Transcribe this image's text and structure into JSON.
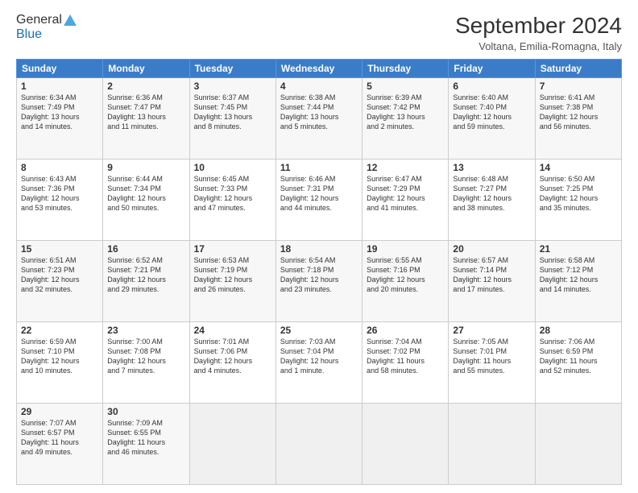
{
  "header": {
    "logo": {
      "line1": "General",
      "line2": "Blue"
    },
    "title": "September 2024",
    "subtitle": "Voltana, Emilia-Romagna, Italy"
  },
  "days_of_week": [
    "Sunday",
    "Monday",
    "Tuesday",
    "Wednesday",
    "Thursday",
    "Friday",
    "Saturday"
  ],
  "weeks": [
    [
      {
        "day": "1",
        "info": "Sunrise: 6:34 AM\nSunset: 7:49 PM\nDaylight: 13 hours\nand 14 minutes."
      },
      {
        "day": "2",
        "info": "Sunrise: 6:36 AM\nSunset: 7:47 PM\nDaylight: 13 hours\nand 11 minutes."
      },
      {
        "day": "3",
        "info": "Sunrise: 6:37 AM\nSunset: 7:45 PM\nDaylight: 13 hours\nand 8 minutes."
      },
      {
        "day": "4",
        "info": "Sunrise: 6:38 AM\nSunset: 7:44 PM\nDaylight: 13 hours\nand 5 minutes."
      },
      {
        "day": "5",
        "info": "Sunrise: 6:39 AM\nSunset: 7:42 PM\nDaylight: 13 hours\nand 2 minutes."
      },
      {
        "day": "6",
        "info": "Sunrise: 6:40 AM\nSunset: 7:40 PM\nDaylight: 12 hours\nand 59 minutes."
      },
      {
        "day": "7",
        "info": "Sunrise: 6:41 AM\nSunset: 7:38 PM\nDaylight: 12 hours\nand 56 minutes."
      }
    ],
    [
      {
        "day": "8",
        "info": "Sunrise: 6:43 AM\nSunset: 7:36 PM\nDaylight: 12 hours\nand 53 minutes."
      },
      {
        "day": "9",
        "info": "Sunrise: 6:44 AM\nSunset: 7:34 PM\nDaylight: 12 hours\nand 50 minutes."
      },
      {
        "day": "10",
        "info": "Sunrise: 6:45 AM\nSunset: 7:33 PM\nDaylight: 12 hours\nand 47 minutes."
      },
      {
        "day": "11",
        "info": "Sunrise: 6:46 AM\nSunset: 7:31 PM\nDaylight: 12 hours\nand 44 minutes."
      },
      {
        "day": "12",
        "info": "Sunrise: 6:47 AM\nSunset: 7:29 PM\nDaylight: 12 hours\nand 41 minutes."
      },
      {
        "day": "13",
        "info": "Sunrise: 6:48 AM\nSunset: 7:27 PM\nDaylight: 12 hours\nand 38 minutes."
      },
      {
        "day": "14",
        "info": "Sunrise: 6:50 AM\nSunset: 7:25 PM\nDaylight: 12 hours\nand 35 minutes."
      }
    ],
    [
      {
        "day": "15",
        "info": "Sunrise: 6:51 AM\nSunset: 7:23 PM\nDaylight: 12 hours\nand 32 minutes."
      },
      {
        "day": "16",
        "info": "Sunrise: 6:52 AM\nSunset: 7:21 PM\nDaylight: 12 hours\nand 29 minutes."
      },
      {
        "day": "17",
        "info": "Sunrise: 6:53 AM\nSunset: 7:19 PM\nDaylight: 12 hours\nand 26 minutes."
      },
      {
        "day": "18",
        "info": "Sunrise: 6:54 AM\nSunset: 7:18 PM\nDaylight: 12 hours\nand 23 minutes."
      },
      {
        "day": "19",
        "info": "Sunrise: 6:55 AM\nSunset: 7:16 PM\nDaylight: 12 hours\nand 20 minutes."
      },
      {
        "day": "20",
        "info": "Sunrise: 6:57 AM\nSunset: 7:14 PM\nDaylight: 12 hours\nand 17 minutes."
      },
      {
        "day": "21",
        "info": "Sunrise: 6:58 AM\nSunset: 7:12 PM\nDaylight: 12 hours\nand 14 minutes."
      }
    ],
    [
      {
        "day": "22",
        "info": "Sunrise: 6:59 AM\nSunset: 7:10 PM\nDaylight: 12 hours\nand 10 minutes."
      },
      {
        "day": "23",
        "info": "Sunrise: 7:00 AM\nSunset: 7:08 PM\nDaylight: 12 hours\nand 7 minutes."
      },
      {
        "day": "24",
        "info": "Sunrise: 7:01 AM\nSunset: 7:06 PM\nDaylight: 12 hours\nand 4 minutes."
      },
      {
        "day": "25",
        "info": "Sunrise: 7:03 AM\nSunset: 7:04 PM\nDaylight: 12 hours\nand 1 minute."
      },
      {
        "day": "26",
        "info": "Sunrise: 7:04 AM\nSunset: 7:02 PM\nDaylight: 11 hours\nand 58 minutes."
      },
      {
        "day": "27",
        "info": "Sunrise: 7:05 AM\nSunset: 7:01 PM\nDaylight: 11 hours\nand 55 minutes."
      },
      {
        "day": "28",
        "info": "Sunrise: 7:06 AM\nSunset: 6:59 PM\nDaylight: 11 hours\nand 52 minutes."
      }
    ],
    [
      {
        "day": "29",
        "info": "Sunrise: 7:07 AM\nSunset: 6:57 PM\nDaylight: 11 hours\nand 49 minutes."
      },
      {
        "day": "30",
        "info": "Sunrise: 7:09 AM\nSunset: 6:55 PM\nDaylight: 11 hours\nand 46 minutes."
      },
      {
        "day": "",
        "info": ""
      },
      {
        "day": "",
        "info": ""
      },
      {
        "day": "",
        "info": ""
      },
      {
        "day": "",
        "info": ""
      },
      {
        "day": "",
        "info": ""
      }
    ]
  ]
}
